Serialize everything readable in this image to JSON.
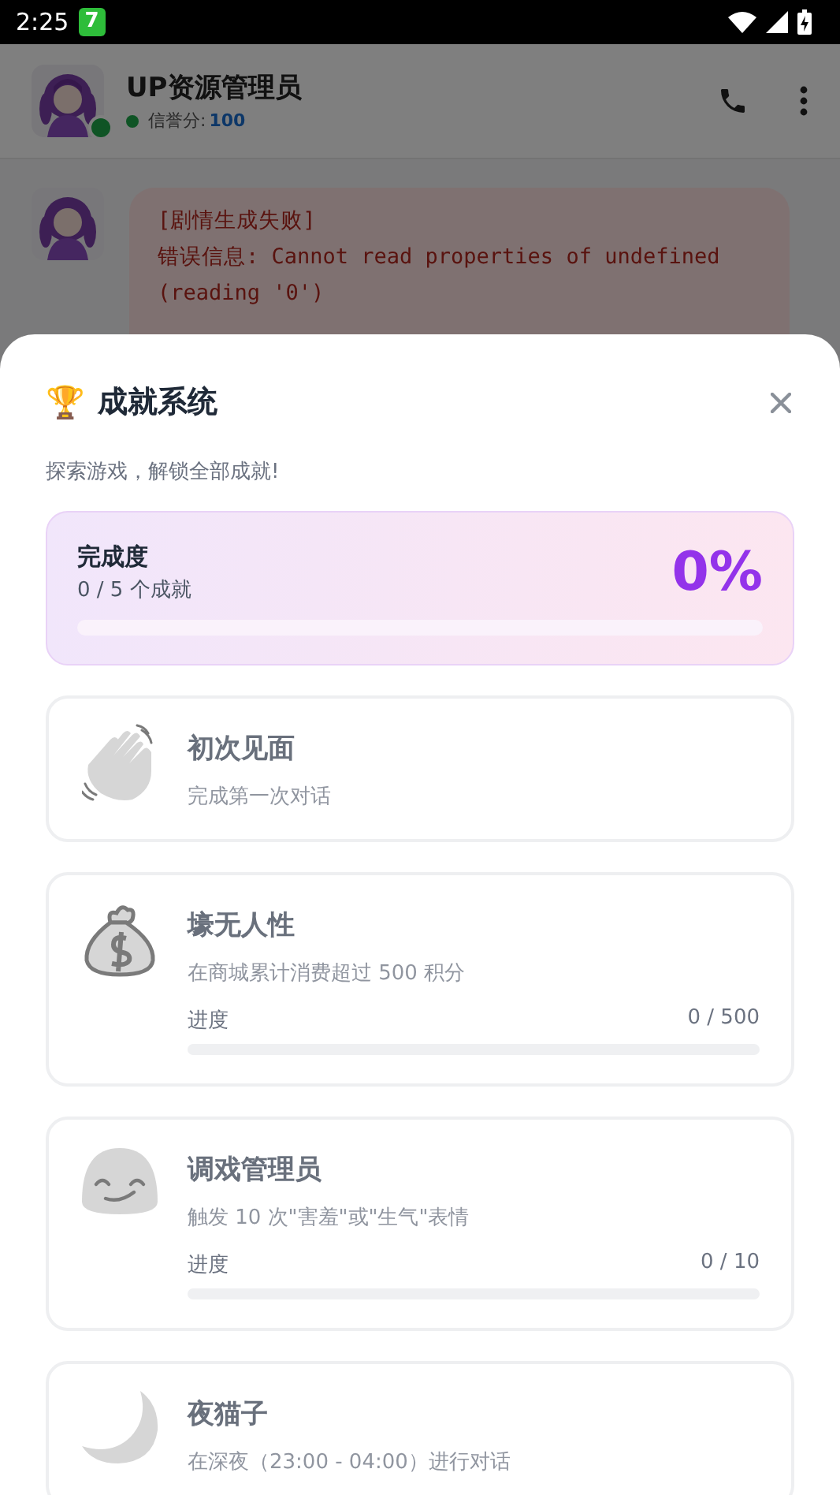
{
  "status_bar": {
    "time": "2:25",
    "notification_badge": "7"
  },
  "chat_header": {
    "title": "UP资源管理员",
    "online": true,
    "credit_label": "信誉分:",
    "credit_value": "100"
  },
  "messages": [
    {
      "lines": [
        "[剧情生成失败]",
        "错误信息: Cannot read properties of undefined (reading '0')"
      ]
    }
  ],
  "sheet": {
    "title_icon": "🏆",
    "title": "成就系统",
    "subtitle": "探索游戏，解锁全部成就!",
    "summary": {
      "label": "完成度",
      "count": "0 / 5 个成就",
      "percent": "0%",
      "level": 0
    },
    "achievements": [
      {
        "title": "初次见面",
        "description": "完成第一次对话",
        "locked": true
      },
      {
        "title": "壕无人性",
        "description": "在商城累计消费超过 500 积分",
        "locked": true,
        "progress_label": "进度",
        "progress_value": "0 / 500",
        "level": 0
      },
      {
        "title": "调戏管理员",
        "description": "触发 10 次\"害羞\"或\"生气\"表情",
        "locked": true,
        "progress_label": "进度",
        "progress_value": "0 / 10",
        "level": 0
      },
      {
        "title": "夜猫子",
        "description": "在深夜（23:00 - 04:00）进行对话",
        "locked": true
      }
    ]
  }
}
